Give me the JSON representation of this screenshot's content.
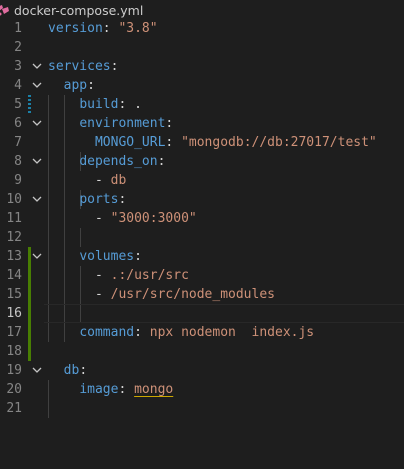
{
  "tab": {
    "filename": "docker-compose.yml",
    "icon": "docker-compose-file-icon"
  },
  "colors": {
    "background": "#1e1e1e",
    "key": "#569cd6",
    "string": "#ce9178",
    "plain": "#d4d4d4",
    "line_number": "#858585",
    "gutter_modified": "#1b81a8",
    "gutter_added": "#487e02"
  },
  "editor": {
    "active_line": 16,
    "lines": [
      {
        "n": "1",
        "key": "version",
        "sep": ": ",
        "val": "\"3.8\"",
        "val_type": "string"
      },
      {
        "n": "2"
      },
      {
        "n": "3",
        "key": "services",
        "sep": ":",
        "fold": true
      },
      {
        "n": "4",
        "indent": "  ",
        "key": "app",
        "sep": ":",
        "fold": true
      },
      {
        "n": "5",
        "indent": "    ",
        "key": "build",
        "sep": ": ",
        "val": ".",
        "val_type": "plain"
      },
      {
        "n": "6",
        "indent": "    ",
        "key": "environment",
        "sep": ":",
        "fold": true
      },
      {
        "n": "7",
        "indent": "      ",
        "key": "MONGO_URL",
        "sep": ": ",
        "val": "\"mongodb://db:27017/test\"",
        "val_type": "string"
      },
      {
        "n": "8",
        "indent": "    ",
        "key": "depends_on",
        "sep": ":",
        "fold": true
      },
      {
        "n": "9",
        "indent": "      ",
        "dash": "- ",
        "val": "db",
        "val_type": "string"
      },
      {
        "n": "10",
        "indent": "    ",
        "key": "ports",
        "sep": ":",
        "fold": true
      },
      {
        "n": "11",
        "indent": "      ",
        "dash": "- ",
        "val": "\"3000:3000\"",
        "val_type": "string"
      },
      {
        "n": "12"
      },
      {
        "n": "13",
        "indent": "    ",
        "key": "volumes",
        "sep": ":",
        "fold": true
      },
      {
        "n": "14",
        "indent": "      ",
        "dash": "- ",
        "val": ".:/usr/src",
        "val_type": "string"
      },
      {
        "n": "15",
        "indent": "      ",
        "dash": "- ",
        "val": "/usr/src/node_modules",
        "val_type": "string"
      },
      {
        "n": "16"
      },
      {
        "n": "17",
        "indent": "    ",
        "key": "command",
        "sep": ": ",
        "val": "npx nodemon  index.js",
        "val_type": "string"
      },
      {
        "n": "18"
      },
      {
        "n": "19",
        "indent": "  ",
        "key": "db",
        "sep": ":",
        "fold": true
      },
      {
        "n": "20",
        "indent": "    ",
        "key": "image",
        "sep": ": ",
        "val": "mongo",
        "val_type": "string",
        "underline": true
      },
      {
        "n": "21"
      }
    ]
  }
}
